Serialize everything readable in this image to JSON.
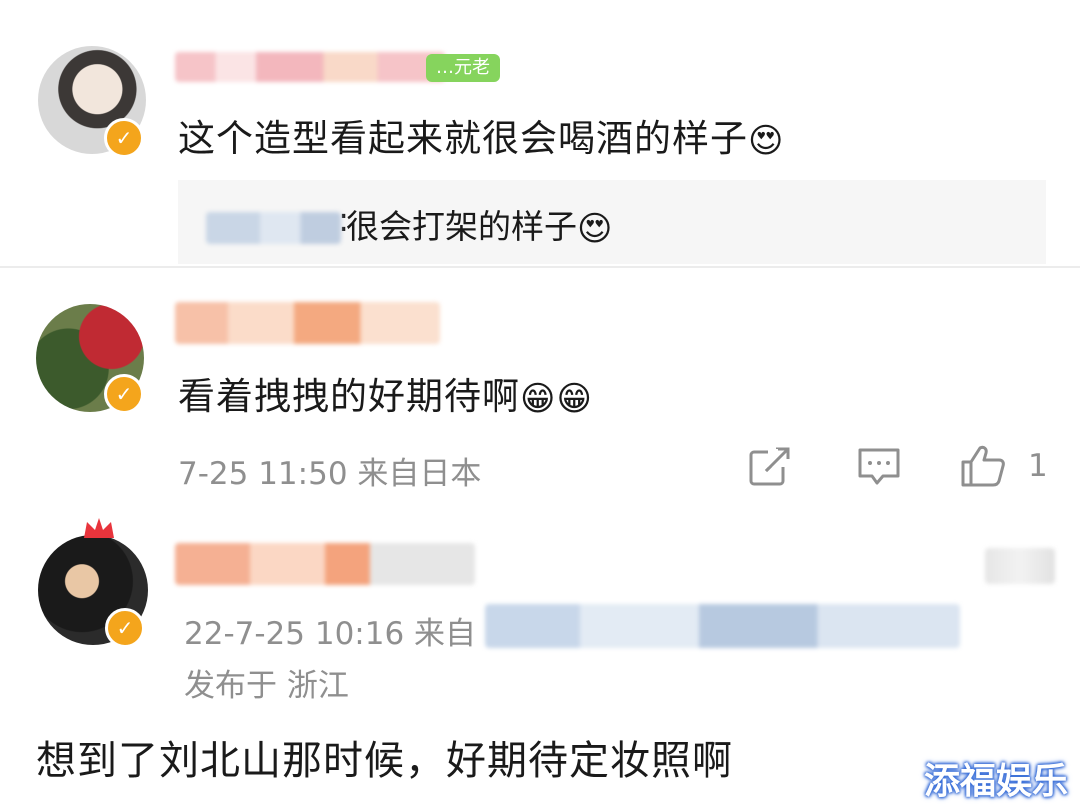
{
  "comments": [
    {
      "level_tag": "…元老",
      "text": "这个造型看起来就很会喝酒的样子",
      "emoji": "😍",
      "reply": {
        "text": "很会打架的样子",
        "emoji": "😍"
      }
    },
    {
      "text": "看着拽拽的好期待啊",
      "emoji": "😁😁",
      "time": "7-25 11:50",
      "source": "来自日本",
      "like_count": "1"
    },
    {
      "time": "22-7-25 10:16",
      "source_prefix": "来自",
      "location": "发布于 浙江"
    }
  ],
  "post": {
    "text": "想到了刘北山那时候，好期待定妆照啊"
  },
  "watermark": "添福娱乐",
  "colors": {
    "badge": "#f4a51c",
    "level_tag": "#86d45d",
    "meta_text": "#8f8f8f",
    "reply_bg": "#f6f6f6"
  },
  "icons": [
    "verified-badge-icon",
    "share-icon",
    "comment-icon",
    "like-icon",
    "crown-icon"
  ]
}
